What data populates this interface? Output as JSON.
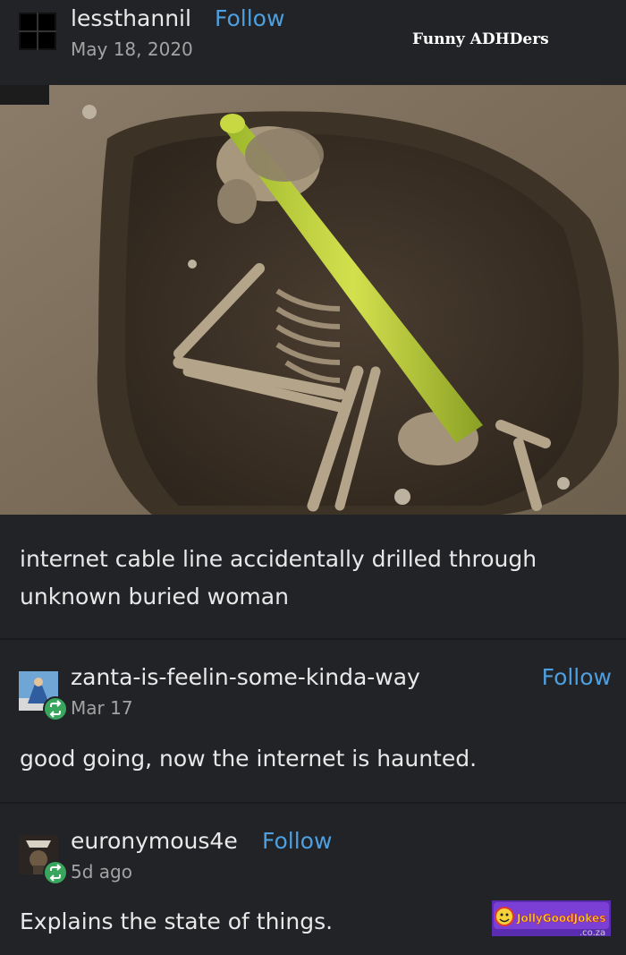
{
  "post": {
    "username": "lessthannil",
    "follow_label": "Follow",
    "date": "May 18, 2020",
    "watermark": "Funny ADHDers",
    "caption": "internet cable line accidentally drilled through unknown buried woman"
  },
  "replies": [
    {
      "username": "zanta-is-feelin-some-kinda-way",
      "follow_label": "Follow",
      "date": "Mar 17",
      "text": "good going, now the internet is haunted."
    },
    {
      "username": "euronymous4e",
      "follow_label": "Follow",
      "date": "5d ago",
      "text": "Explains the state of things."
    }
  ],
  "branding": {
    "logo_text": "JollyGoodJokes",
    "logo_domain": ".co.za"
  },
  "colors": {
    "background": "#222326",
    "link": "#4d9fe0",
    "reblog": "#3aa55d"
  }
}
